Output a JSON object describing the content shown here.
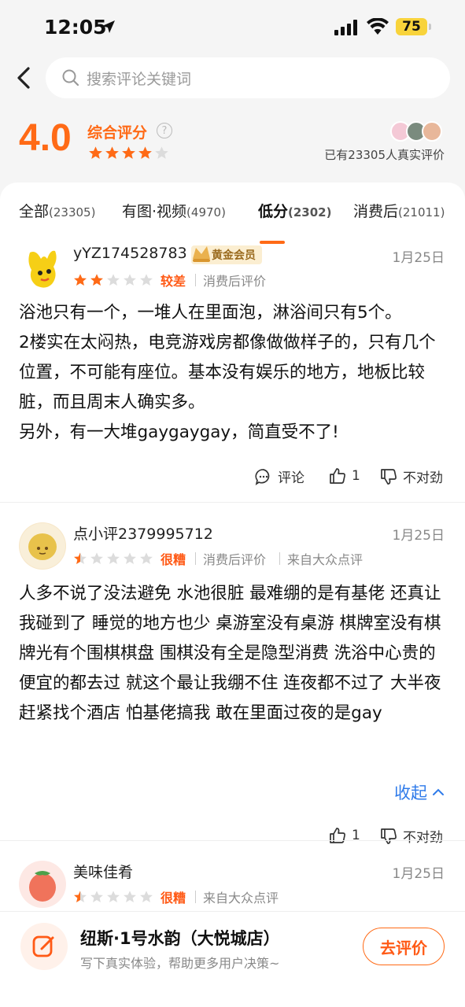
{
  "status_bar": {
    "time": "12:05",
    "battery": "75"
  },
  "search": {
    "placeholder": "搜索评论关键词"
  },
  "summary": {
    "score": "4.0",
    "label": "综合评分",
    "help": "?",
    "stars_filled": 4,
    "stars_total": 5,
    "review_total_text": "已有23305人真实评价"
  },
  "tabs": [
    {
      "label": "全部",
      "count": "(23305)",
      "active": false
    },
    {
      "label": "有图·视频",
      "count": "(4970)",
      "active": false
    },
    {
      "label": "低分",
      "count": "(2302)",
      "active": true
    },
    {
      "label": "消费后",
      "count": "(21011)",
      "active": false
    }
  ],
  "reviews": [
    {
      "user": "yYZ174528783",
      "badge": "黄金会员",
      "date": "1月25日",
      "stars": 2,
      "level": "较差",
      "tags": [
        "消费后评价"
      ],
      "body": "浴池只有一个，一堆人在里面泡，淋浴间只有5个。\n2楼实在太闷热，电竞游戏房都像做做样子的，只有几个位置，不可能有座位。基本没有娱乐的地方，地板比较脏，而且周末人确实多。\n另外，有一大堆gaygaygay，简直受不了!",
      "comment_label": "评论",
      "like_count": "1",
      "report_label": "不对劲"
    },
    {
      "user": "点小评2379995712",
      "date": "1月25日",
      "stars": 0.5,
      "level": "很糟",
      "tags": [
        "消费后评价",
        "来自大众点评"
      ],
      "body": "人多不说了没法避免 水池很脏 最难绷的是有基佬 还真让我碰到了 睡觉的地方也少 桌游室没有桌游 棋牌室没有棋牌光有个围棋棋盘 围棋没有全是隐型消费 洗浴中心贵的便宜的都去过 就这个最让我绷不住 连夜都不过了 大半夜赶紧找个酒店 怕基佬搞我 敢在里面过夜的是gay",
      "collapse_label": "收起",
      "like_count": "1",
      "report_label": "不对劲"
    },
    {
      "user": "美味佳肴",
      "date": "1月25日",
      "stars": 0.5,
      "level": "很糟",
      "tags": [
        "来自大众点评"
      ]
    }
  ],
  "bottom_bar": {
    "title": "纽斯·1号水韵（大悦城店）",
    "subtitle": "写下真实体验，帮助更多用户决策~",
    "button": "去评价"
  },
  "colors": {
    "accent": "#ff6a16",
    "link": "#2f7bea",
    "star_empty": "#dcdcdc"
  }
}
